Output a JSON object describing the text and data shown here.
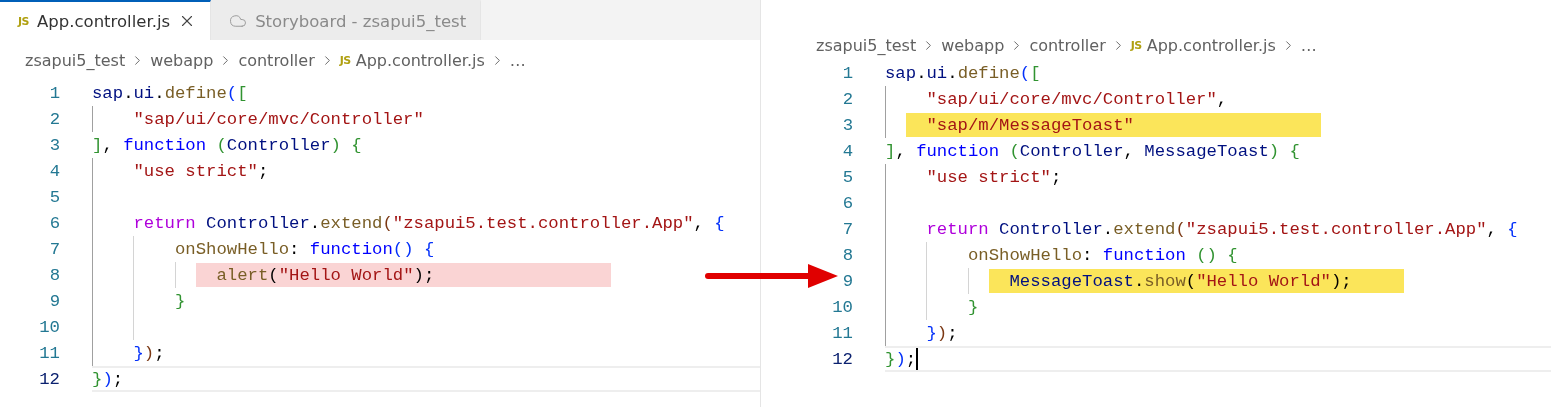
{
  "panes": [
    {
      "tabs": [
        {
          "kind": "file",
          "badge": "JS",
          "label": "App.controller.js",
          "selected": true,
          "closable": true
        },
        {
          "kind": "storyboard",
          "label": "Storyboard - zsapui5_test",
          "selected": false,
          "closable": false
        }
      ],
      "breadcrumb": [
        {
          "kind": "folder",
          "text": "zsapui5_test"
        },
        {
          "kind": "folder",
          "text": "webapp"
        },
        {
          "kind": "folder",
          "text": "controller"
        },
        {
          "kind": "file",
          "badge": "JS",
          "text": "App.controller.js"
        },
        {
          "kind": "more",
          "text": "…"
        }
      ],
      "cursor": false,
      "lines": [
        {
          "number": "1",
          "current": false,
          "kind": "plain",
          "tokens": [
            {
              "text": "sap",
              "kind": "var"
            },
            {
              "text": ".",
              "kind": "p"
            },
            {
              "text": "ui",
              "kind": "var"
            },
            {
              "text": ".",
              "kind": "p"
            },
            {
              "text": "define",
              "kind": "fn"
            },
            {
              "text": "(",
              "kind": "b1"
            },
            {
              "text": "[",
              "kind": "b2"
            }
          ]
        },
        {
          "number": "2",
          "current": false,
          "kind": "plain",
          "tokens": [
            {
              "text": "    \"sap/ui/core/mvc/Controller\"",
              "kind": "str"
            }
          ]
        },
        {
          "number": "3",
          "current": false,
          "kind": "plain",
          "tokens": [
            {
              "text": "]",
              "kind": "b2"
            },
            {
              "text": ", ",
              "kind": "p"
            },
            {
              "text": "function",
              "kind": "kw"
            },
            {
              "text": " (",
              "kind": "b2"
            },
            {
              "text": "Controller",
              "kind": "var"
            },
            {
              "text": ")",
              "kind": "b2"
            },
            {
              "text": " {",
              "kind": "b2"
            }
          ]
        },
        {
          "number": "4",
          "current": false,
          "kind": "plain",
          "tokens": [
            {
              "text": "    \"use strict\"",
              "kind": "str"
            },
            {
              "text": ";",
              "kind": "p"
            }
          ]
        },
        {
          "number": "5",
          "current": false,
          "kind": "plain"
        },
        {
          "number": "6",
          "current": false,
          "kind": "plain",
          "tokens": [
            {
              "text": "    return",
              "kind": "ctl"
            },
            {
              "text": " Controller",
              "kind": "var"
            },
            {
              "text": ".",
              "kind": "p"
            },
            {
              "text": "extend",
              "kind": "fn"
            },
            {
              "text": "(",
              "kind": "b3"
            },
            {
              "text": "\"zsapui5.test.controller.App\"",
              "kind": "str"
            },
            {
              "text": ", ",
              "kind": "p"
            },
            {
              "text": "{",
              "kind": "b1"
            }
          ]
        },
        {
          "number": "7",
          "current": false,
          "kind": "plain",
          "tokens": [
            {
              "text": "        onShowHello",
              "kind": "fn"
            },
            {
              "text": ": ",
              "kind": "p"
            },
            {
              "text": "function",
              "kind": "kw"
            },
            {
              "text": "()",
              "kind": "b1"
            },
            {
              "text": " {",
              "kind": "b1"
            }
          ]
        },
        {
          "number": "8",
          "current": false,
          "kind": "removed",
          "tokens": [
            {
              "text": "            alert",
              "kind": "fn"
            },
            {
              "text": "(",
              "kind": "p"
            },
            {
              "text": "\"Hello World\"",
              "kind": "str"
            },
            {
              "text": ");",
              "kind": "p"
            }
          ]
        },
        {
          "number": "9",
          "current": false,
          "kind": "plain",
          "tokens": [
            {
              "text": "        }",
              "kind": "b2"
            }
          ]
        },
        {
          "number": "10",
          "current": false,
          "kind": "plain"
        },
        {
          "number": "11",
          "current": false,
          "kind": "plain",
          "tokens": [
            {
              "text": "    }",
              "kind": "b1"
            },
            {
              "text": ")",
              "kind": "b3"
            },
            {
              "text": ";",
              "kind": "p"
            }
          ]
        },
        {
          "number": "12",
          "current": true,
          "kind": "plain",
          "tokens": [
            {
              "text": "}",
              "kind": "b2"
            },
            {
              "text": ")",
              "kind": "b1"
            },
            {
              "text": ";",
              "kind": "p"
            }
          ]
        }
      ]
    },
    {
      "breadcrumb": [
        {
          "kind": "folder",
          "text": "zsapui5_test"
        },
        {
          "kind": "folder",
          "text": "webapp"
        },
        {
          "kind": "folder",
          "text": "controller"
        },
        {
          "kind": "file",
          "badge": "JS",
          "text": "App.controller.js"
        },
        {
          "kind": "more",
          "text": "…"
        }
      ],
      "cursor": true,
      "lines": [
        {
          "number": "1",
          "current": false,
          "kind": "plain",
          "tokens": [
            {
              "text": "sap",
              "kind": "var"
            },
            {
              "text": ".",
              "kind": "p"
            },
            {
              "text": "ui",
              "kind": "var"
            },
            {
              "text": ".",
              "kind": "p"
            },
            {
              "text": "define",
              "kind": "fn"
            },
            {
              "text": "(",
              "kind": "b1"
            },
            {
              "text": "[",
              "kind": "b2"
            }
          ]
        },
        {
          "number": "2",
          "current": false,
          "kind": "plain",
          "tokens": [
            {
              "text": "    \"sap/ui/core/mvc/Controller\"",
              "kind": "str"
            },
            {
              "text": ",",
              "kind": "p"
            }
          ]
        },
        {
          "number": "3",
          "current": false,
          "kind": "added",
          "tokens": [
            {
              "text": "    \"sap/m/MessageToast\"",
              "kind": "str"
            }
          ]
        },
        {
          "number": "4",
          "current": false,
          "kind": "plain",
          "tokens": [
            {
              "text": "]",
              "kind": "b2"
            },
            {
              "text": ", ",
              "kind": "p"
            },
            {
              "text": "function",
              "kind": "kw"
            },
            {
              "text": " (",
              "kind": "b2"
            },
            {
              "text": "Controller",
              "kind": "var"
            },
            {
              "text": ", ",
              "kind": "p"
            },
            {
              "text": "MessageToast",
              "kind": "var"
            },
            {
              "text": ")",
              "kind": "b2"
            },
            {
              "text": " {",
              "kind": "b2"
            }
          ]
        },
        {
          "number": "5",
          "current": false,
          "kind": "plain",
          "tokens": [
            {
              "text": "    \"use strict\"",
              "kind": "str"
            },
            {
              "text": ";",
              "kind": "p"
            }
          ]
        },
        {
          "number": "6",
          "current": false,
          "kind": "plain"
        },
        {
          "number": "7",
          "current": false,
          "kind": "plain",
          "tokens": [
            {
              "text": "    return",
              "kind": "ctl"
            },
            {
              "text": " Controller",
              "kind": "var"
            },
            {
              "text": ".",
              "kind": "p"
            },
            {
              "text": "extend",
              "kind": "fn"
            },
            {
              "text": "(",
              "kind": "b3"
            },
            {
              "text": "\"zsapui5.test.controller.App\"",
              "kind": "str"
            },
            {
              "text": ", ",
              "kind": "p"
            },
            {
              "text": "{",
              "kind": "b1"
            }
          ]
        },
        {
          "number": "8",
          "current": false,
          "kind": "plain",
          "tokens": [
            {
              "text": "        onShowHello",
              "kind": "fn"
            },
            {
              "text": ": ",
              "kind": "p"
            },
            {
              "text": "function",
              "kind": "kw"
            },
            {
              "text": " ()",
              "kind": "b2"
            },
            {
              "text": " {",
              "kind": "b2"
            }
          ]
        },
        {
          "number": "9",
          "current": false,
          "kind": "added",
          "tokens": [
            {
              "text": "            MessageToast",
              "kind": "var"
            },
            {
              "text": ".",
              "kind": "p"
            },
            {
              "text": "show",
              "kind": "fn"
            },
            {
              "text": "(",
              "kind": "p"
            },
            {
              "text": "\"Hello World\"",
              "kind": "str"
            },
            {
              "text": ");",
              "kind": "p"
            }
          ]
        },
        {
          "number": "10",
          "current": false,
          "kind": "plain",
          "tokens": [
            {
              "text": "        }",
              "kind": "b2"
            }
          ]
        },
        {
          "number": "11",
          "current": false,
          "kind": "plain",
          "tokens": [
            {
              "text": "    }",
              "kind": "b1"
            },
            {
              "text": ")",
              "kind": "b3"
            },
            {
              "text": ";",
              "kind": "p"
            }
          ]
        },
        {
          "number": "12",
          "current": true,
          "kind": "plain",
          "tokens": [
            {
              "text": "}",
              "kind": "b2"
            },
            {
              "text": ")",
              "kind": "b1"
            },
            {
              "text": ";",
              "kind": "p"
            }
          ]
        }
      ]
    }
  ]
}
